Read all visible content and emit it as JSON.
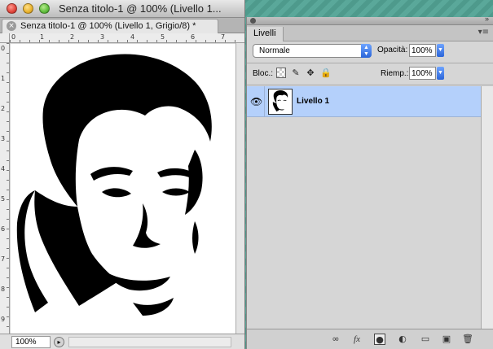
{
  "document": {
    "window_title": "Senza titolo-1 @ 100% (Livello 1...",
    "tab_label": "Senza titolo-1 @ 100% (Livello 1, Grigio/8) *",
    "tab_close_glyph": "×",
    "ruler_h_ticks": [
      "0",
      "1",
      "2",
      "3",
      "4",
      "5",
      "6",
      "7"
    ],
    "ruler_v_ticks": [
      "0",
      "1",
      "2",
      "3",
      "4",
      "5",
      "6",
      "7",
      "8",
      "9"
    ],
    "zoom": "100%"
  },
  "panel": {
    "tab_label": "Livelli",
    "collapse_glyph": "»",
    "menu_glyph": "▾≡",
    "blend_mode": "Normale",
    "opacity_label": "Opacità:",
    "opacity_value": "100%",
    "lock_label": "Bloc.:",
    "fill_label": "Riemp.:",
    "fill_value": "100%",
    "lock_icons": {
      "paint": "✎",
      "move": "✥",
      "all": "🔒"
    },
    "layers": [
      {
        "name": "Livello 1",
        "visible": true,
        "selected": true
      }
    ],
    "footer_icons": [
      "link-icon",
      "fx-icon",
      "mask-icon",
      "adjustment-icon",
      "group-icon",
      "new-layer-icon",
      "trash-icon"
    ]
  },
  "colors": {
    "selection": "#b4d0fb",
    "panel_bg": "#d6d6d6",
    "accent_blue": "#2a64d8"
  }
}
